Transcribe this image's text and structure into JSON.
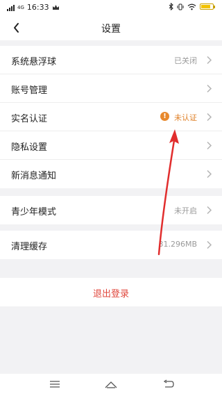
{
  "status_bar": {
    "network": "4G",
    "time": "16:33",
    "icons": [
      "signal-icon",
      "crown-icon",
      "bluetooth-icon",
      "vibrate-icon",
      "wifi-icon",
      "battery-icon"
    ]
  },
  "header": {
    "title": "设置",
    "back_icon": "chevron-left-icon"
  },
  "groups": [
    {
      "rows": [
        {
          "label": "系统悬浮球",
          "value": "已关闭"
        },
        {
          "label": "账号管理",
          "value": ""
        },
        {
          "label": "实名认证",
          "value": "未认证",
          "status_color": "#e0822a"
        },
        {
          "label": "隐私设置",
          "value": ""
        },
        {
          "label": "新消息通知",
          "value": ""
        }
      ]
    },
    {
      "rows": [
        {
          "label": "青少年模式",
          "value": "未开启"
        }
      ]
    },
    {
      "rows": [
        {
          "label": "清理缓存",
          "value": "31.296MB"
        }
      ]
    }
  ],
  "logout": {
    "label": "退出登录",
    "color": "#e0463b"
  },
  "nav_bar": {
    "icons": [
      "menu-icon",
      "home-icon",
      "back-icon"
    ]
  },
  "colors": {
    "annotation_arrow": "#e12d2d",
    "background": "#f2f2f4"
  }
}
